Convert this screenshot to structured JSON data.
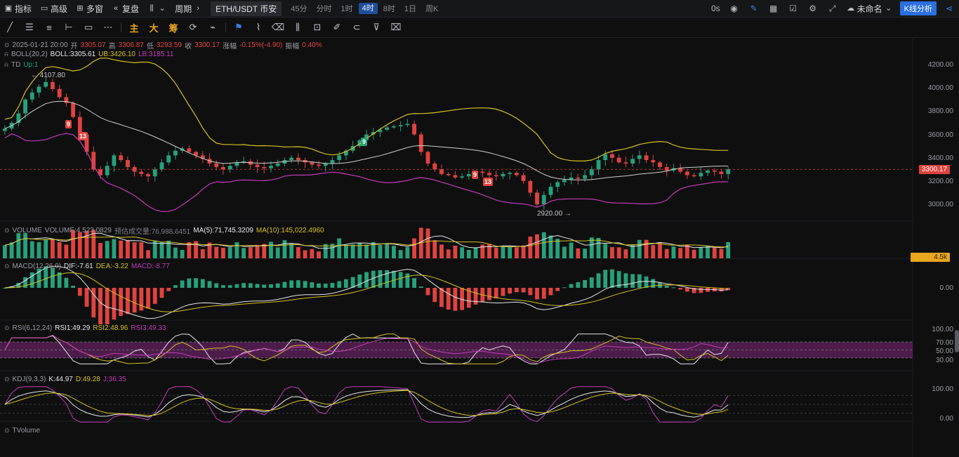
{
  "topbar": {
    "indicators": "指标",
    "advanced": "高级",
    "multi_window": "多窗",
    "replay": "复盘",
    "period_label": "周期",
    "symbol": "ETH/USDT 币安",
    "periods": [
      "45分",
      "分时",
      "1时",
      "4时",
      "8时",
      "1日",
      "周K"
    ],
    "active_period": "4时",
    "countdown": "0s",
    "layout_name": "未命名",
    "analysis_button": "K线分析"
  },
  "toolbar": {
    "main_label": "主",
    "big_label": "大",
    "chip_label": "筹"
  },
  "ohlc": {
    "date": "2025-01-21 20:00",
    "open_label": "开",
    "open": "3305.07",
    "high_label": "高",
    "high": "3306.87",
    "low_label": "低",
    "low": "3293.59",
    "close_label": "收",
    "close": "3300.17",
    "change_label": "涨幅",
    "change": "-0.15%(-4.90)",
    "amplitude_label": "振幅",
    "amplitude": "0.40%"
  },
  "boll": {
    "name": "BOLL(20,2)",
    "mid": "BOLL:3305.61",
    "ub": "UB:3426.10",
    "lb": "LB:3185.11"
  },
  "td": {
    "name": "TD",
    "up": "Up:1",
    "markers": [
      "9",
      "13",
      "9",
      "9",
      "13"
    ]
  },
  "price_extremes": {
    "high": "← 4107.80",
    "low": "2920.00 →"
  },
  "price_axis": [
    "4200.00",
    "4000.00",
    "3800.00",
    "3600.00",
    "3400.00",
    "3200.00",
    "3000.00"
  ],
  "last_price": "3300.17",
  "volume": {
    "name": "VOLUME",
    "value": "VOLUME:4,523.0829",
    "estimate": "预估成交量:76,988.6451",
    "ma5": "MA(5):71,745.3209",
    "ma10": "MA(10):145,022.4960",
    "tag": "4.5k"
  },
  "macd": {
    "name": "MACD(12,26,9)",
    "dif": "DIF:-7.61",
    "dea": "DEA:-3.22",
    "macd": "MACD:-8.77",
    "axis": "0.00"
  },
  "rsi": {
    "name": "RSI(6,12,24)",
    "rsi1": "RSI1:49.29",
    "rsi2": "RSI2:48.96",
    "rsi3": "RSI3:49.33",
    "axis": [
      "100.00",
      "70.00",
      "50.00",
      "30.00"
    ]
  },
  "kdj": {
    "name": "KDJ(9,3,3)",
    "k": "K:44.97",
    "d": "D:49.28",
    "j": "J:36.35",
    "axis": [
      "100.00",
      "0.00"
    ]
  },
  "tvolume": {
    "name": "TVolume"
  },
  "colors": {
    "up": "#26a17b",
    "down": "#e0433f",
    "boll_ub": "#d4c21f",
    "boll_lb": "#c23bb5",
    "boll_mid": "#cfcfcf",
    "accent": "#2b6fe0"
  },
  "chart_data": {
    "type": "candlestick",
    "symbol": "ETH/USDT",
    "interval": "4h",
    "ylim": [
      2900,
      4250
    ],
    "close": [
      3650,
      3700,
      3780,
      3900,
      3960,
      4010,
      4050,
      3990,
      3920,
      3870,
      3750,
      3600,
      3450,
      3300,
      3250,
      3330,
      3420,
      3380,
      3320,
      3280,
      3260,
      3240,
      3300,
      3360,
      3420,
      3460,
      3480,
      3450,
      3420,
      3390,
      3350,
      3320,
      3300,
      3330,
      3360,
      3370,
      3340,
      3320,
      3310,
      3330,
      3350,
      3380,
      3400,
      3380,
      3360,
      3340,
      3330,
      3350,
      3380,
      3420,
      3460,
      3500,
      3550,
      3600,
      3620,
      3640,
      3660,
      3670,
      3680,
      3690,
      3600,
      3450,
      3350,
      3300,
      3260,
      3250,
      3230,
      3240,
      3260,
      3280,
      3270,
      3250,
      3240,
      3260,
      3270,
      3250,
      3200,
      3100,
      3000,
      3080,
      3150,
      3190,
      3210,
      3230,
      3220,
      3250,
      3300,
      3380,
      3430,
      3400,
      3360,
      3350,
      3390,
      3420,
      3380,
      3360,
      3320,
      3290,
      3310,
      3280,
      3250,
      3240,
      3270,
      3290,
      3280,
      3260,
      3300
    ]
  }
}
